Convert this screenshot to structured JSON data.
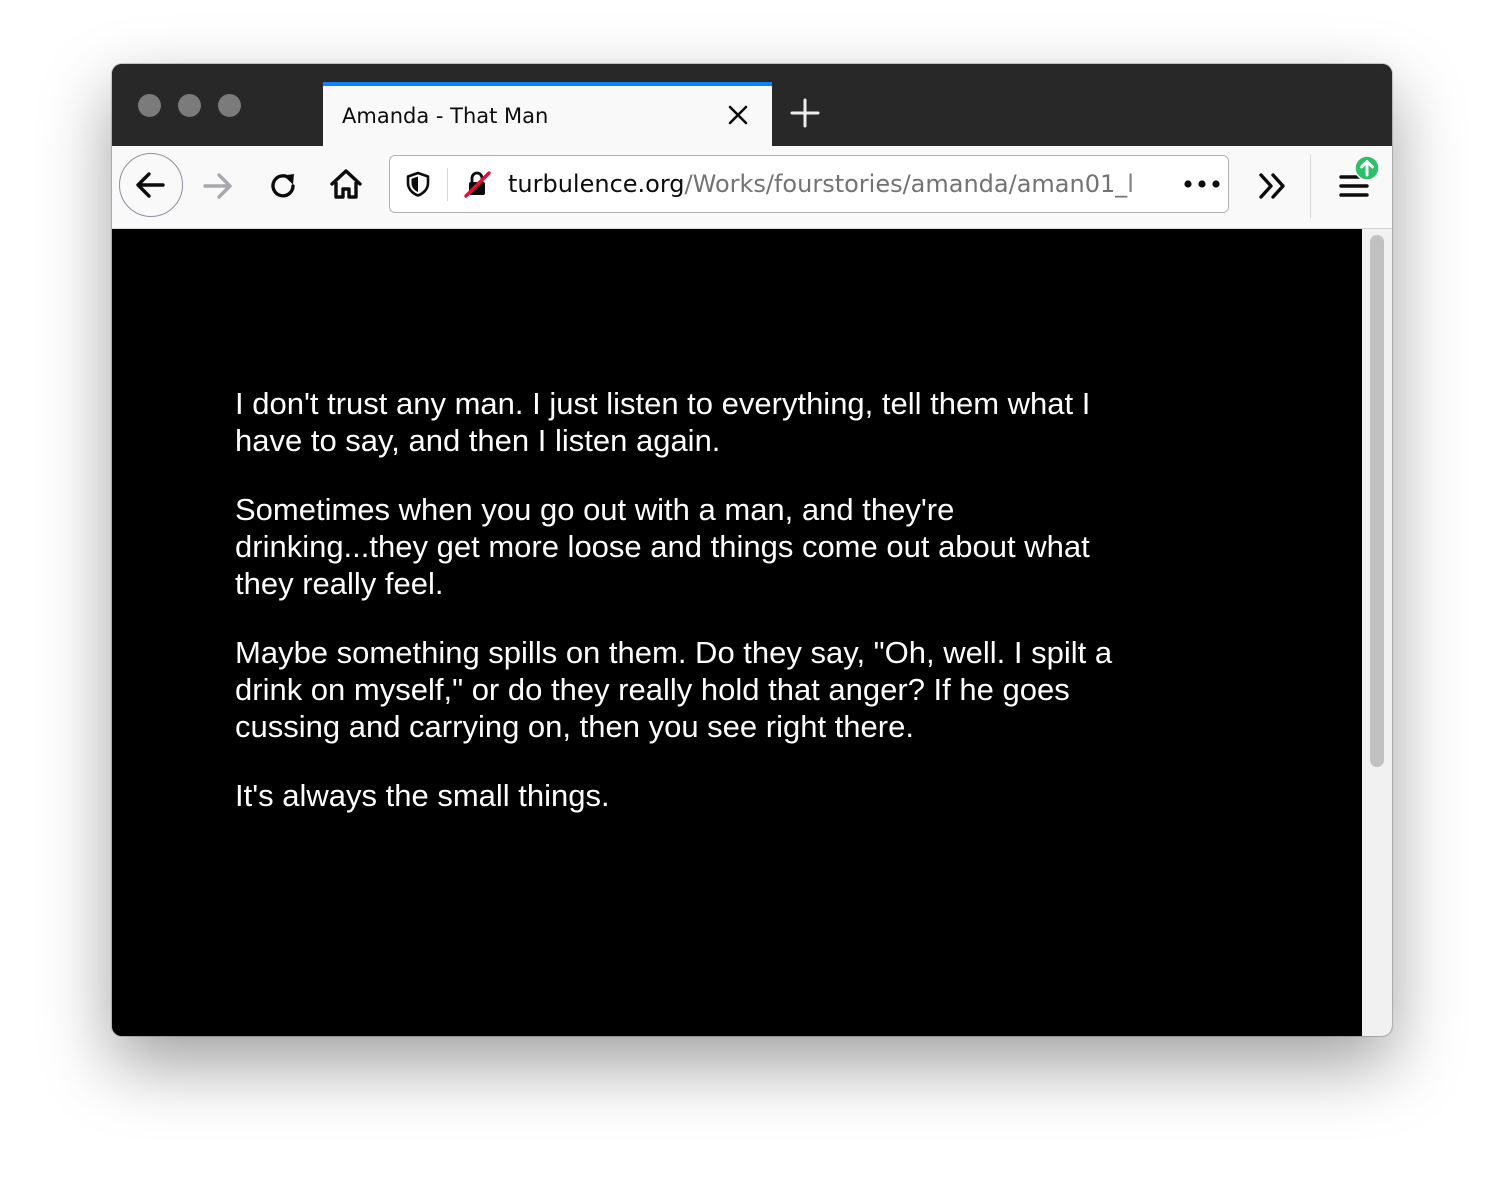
{
  "tab": {
    "title": "Amanda - That Man"
  },
  "urlbar": {
    "host": "turbulence.org",
    "path": "/Works/fourstories/amanda/aman01_l"
  },
  "icons": {
    "back": "arrow-left-icon",
    "forward": "arrow-right-icon",
    "reload": "reload-icon",
    "home": "home-icon",
    "tracking_protection": "shield-icon",
    "insecure_connection": "lock-crossed-icon",
    "page_actions": "ellipsis-icon",
    "overflow": "chevron-double-right-icon",
    "menu": "hamburger-menu-icon",
    "update_badge": "update-arrow-icon",
    "close_tab": "close-icon",
    "new_tab": "plus-icon"
  },
  "colors": {
    "tab_accent": "#0a84ff",
    "titlebar": "#282828",
    "page_background": "#000000",
    "page_text": "#ffffff",
    "update_badge": "#2ac16a"
  },
  "page": {
    "paragraphs": [
      "I don't trust any man. I just listen to everything, tell them what I have to say, and then I listen again.",
      "Sometimes when you go out with a man, and they're drinking...they get more loose and things come out about what they really feel.",
      "Maybe something spills on them. Do they say, \"Oh, well. I spilt a drink on myself,\" or do they really hold that anger? If he goes cussing and carrying on, then you see right there.",
      "It's always the small things."
    ]
  }
}
